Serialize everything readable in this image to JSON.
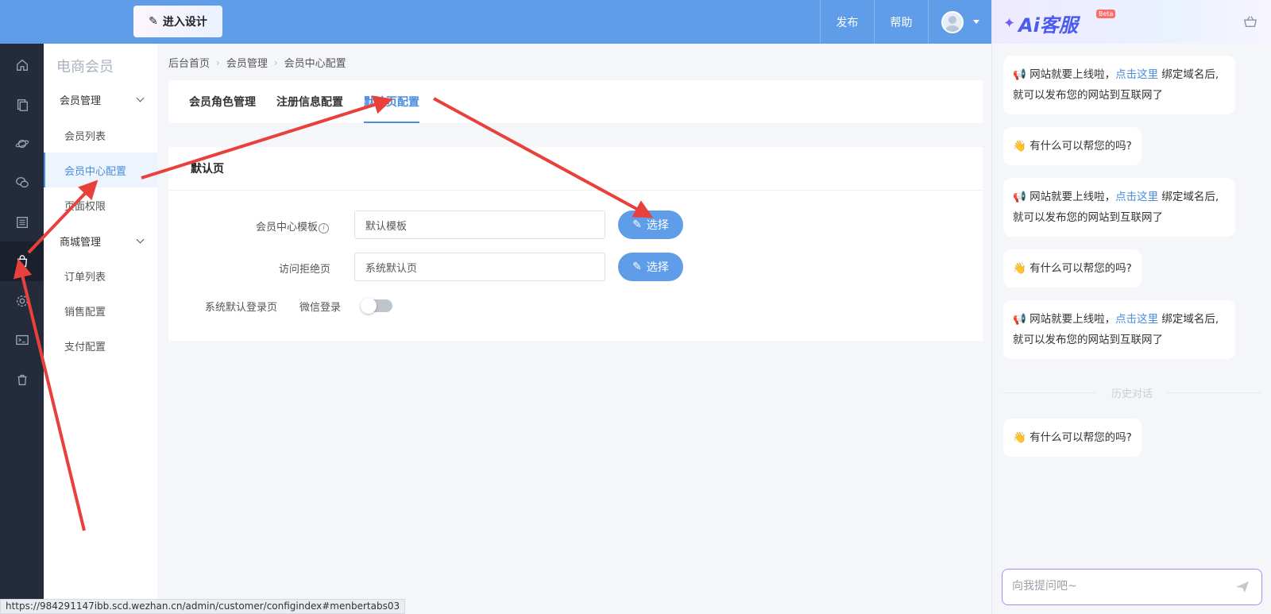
{
  "topbar": {
    "design_label": "进入设计",
    "publish_label": "发布",
    "help_label": "帮助"
  },
  "rail": {
    "items": [
      "home-icon",
      "pages-icon",
      "planet-icon",
      "wechat-icon",
      "list-icon",
      "member-bag-icon",
      "settings-icon",
      "terminal-icon",
      "trash-icon"
    ],
    "active_index": 5
  },
  "subnav": {
    "title": "电商会员",
    "groups": [
      {
        "label": "会员管理",
        "items": [
          "会员列表",
          "会员中心配置",
          "页面权限"
        ]
      },
      {
        "label": "商城管理",
        "items": [
          "订单列表",
          "销售配置",
          "支付配置"
        ]
      }
    ],
    "active_item": "会员中心配置"
  },
  "breadcrumb": [
    "后台首页",
    "会员管理",
    "会员中心配置"
  ],
  "tabs": [
    {
      "label": "会员角色管理",
      "active": false
    },
    {
      "label": "注册信息配置",
      "active": false
    },
    {
      "label": "默认页配置",
      "active": true
    }
  ],
  "form": {
    "card_title": "默认页",
    "template_label": "会员中心模板",
    "template_value": "默认模板",
    "denied_label": "访问拒绝页",
    "denied_value": "系统默认页",
    "choose_label": "选择",
    "login_label": "系统默认登录页",
    "wechat_label": "微信登录",
    "wechat_enabled": false
  },
  "chat": {
    "logo": "Ai客服",
    "beta": "Beta",
    "msg_launch_pre": "网站就要上线啦，",
    "msg_launch_link": "点击这里",
    "msg_launch_post": "绑定域名后,就可以发布您的网站到互联网了",
    "msg_help": "有什么可以帮您的吗?",
    "history_label": "历史对话",
    "input_placeholder": "向我提问吧~"
  },
  "status_url": "https://984291147ibb.scd.wezhan.cn/admin/customer/configindex#menbertabs03",
  "colors": {
    "accent": "#5f9de8",
    "rail": "#242b3a",
    "annotation": "#e8413c"
  }
}
